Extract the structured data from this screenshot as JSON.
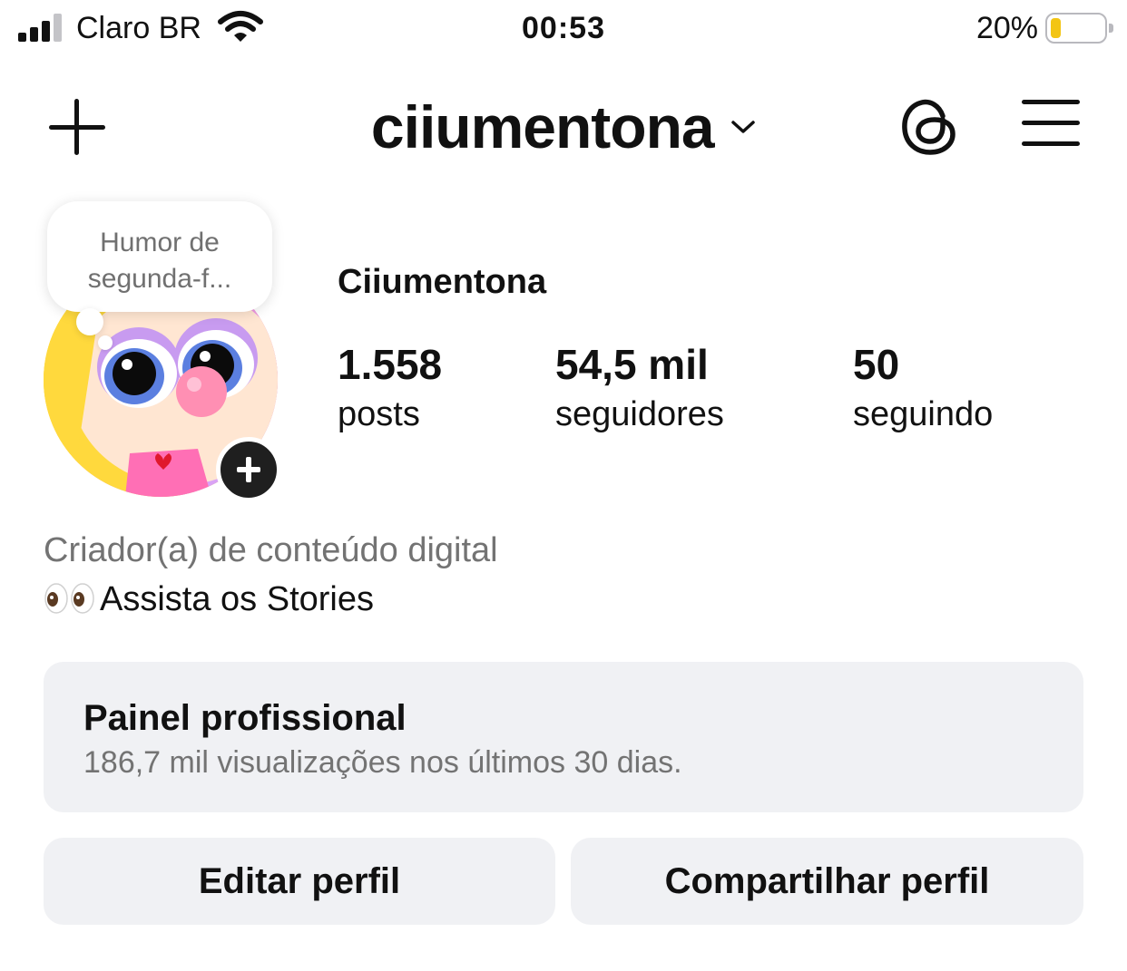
{
  "status_bar": {
    "carrier": "Claro BR",
    "time": "00:53",
    "battery_percent_label": "20%",
    "battery_level": 0.2,
    "battery_color": "#f3c514"
  },
  "header": {
    "username": "ciiumentona",
    "icons": [
      "plus-icon",
      "chevron-down-icon",
      "threads-icon",
      "hamburger-menu-icon"
    ]
  },
  "profile": {
    "note": "Humor de segunda-f...",
    "display_name": "Ciiumentona",
    "stats": [
      {
        "value": "1.558",
        "label": "posts"
      },
      {
        "value": "54,5 mil",
        "label": "seguidores"
      },
      {
        "value": "50",
        "label": "seguindo"
      }
    ],
    "category": "Criador(a) de conteúdo digital",
    "bio": "Assista os Stories"
  },
  "dashboard": {
    "title": "Painel profissional",
    "subtitle": "186,7 mil visualizações nos últimos 30 dias."
  },
  "actions": {
    "edit_label": "Editar perfil",
    "share_label": "Compartilhar perfil"
  }
}
